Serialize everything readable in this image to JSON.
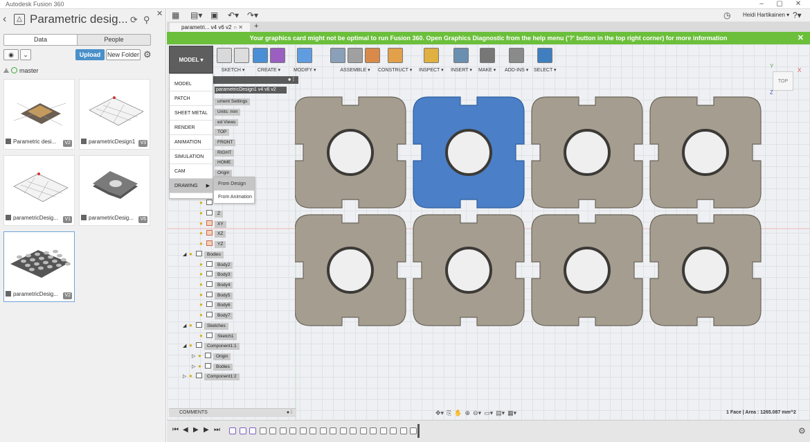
{
  "window": {
    "title": "Autodesk Fusion 360",
    "min": "–",
    "max": "▢",
    "close": "✕"
  },
  "data_panel": {
    "project_title": "Parametric desig...",
    "tabs": [
      {
        "label": "Data",
        "active": true
      },
      {
        "label": "People",
        "active": false
      }
    ],
    "upload_label": "Upload",
    "new_folder_label": "New Folder",
    "branch": "master",
    "thumbnails": [
      {
        "name": "Parametric desi...",
        "version": "V2",
        "kind": "tile",
        "selected": false
      },
      {
        "name": "parametricDesign1",
        "version": "V3",
        "kind": "assembly",
        "selected": false
      },
      {
        "name": "parametricDesig...",
        "version": "V1",
        "kind": "assembly",
        "selected": false
      },
      {
        "name": "parametricDesig...",
        "version": "V6",
        "kind": "cross",
        "selected": false
      },
      {
        "name": "parametricDesig...",
        "version": "V2",
        "kind": "grid",
        "selected": true
      }
    ]
  },
  "app": {
    "user_name": "Heidi Hartikainen ▾",
    "doc_tab": "parametri... v4 v6 v2",
    "warning": "Your graphics card might not be optimal to run Fusion 360. Open Graphics Diagnostic from the help menu ('?' button in the top right corner) for more information",
    "workspace_button": "MODEL ▾",
    "ribbon_groups": [
      {
        "label": "SKETCH ▾",
        "colors": [
          "#d9d9d9",
          "#dddddd"
        ]
      },
      {
        "label": "CREATE ▾",
        "colors": [
          "#4a8fd6",
          "#9a5fc0"
        ]
      },
      {
        "label": "MODIFY ▾",
        "colors": [
          "#5f9de0"
        ]
      },
      {
        "label": "ASSEMBLE ▾",
        "colors": [
          "#8aa0b8",
          "#a0a0a0",
          "#d98a4a"
        ]
      },
      {
        "label": "CONSTRUCT ▾",
        "colors": [
          "#e2a04a"
        ]
      },
      {
        "label": "INSPECT ▾",
        "colors": [
          "#e0b040"
        ]
      },
      {
        "label": "INSERT ▾",
        "colors": [
          "#6a8fb0"
        ]
      },
      {
        "label": "MAKE ▾",
        "colors": [
          "#777777"
        ]
      },
      {
        "label": "ADD-INS ▾",
        "colors": [
          "#8a8a8a"
        ]
      },
      {
        "label": "SELECT ▾",
        "colors": [
          "#3f7fbf"
        ]
      }
    ],
    "workspaces": [
      {
        "label": "MODEL"
      },
      {
        "label": "PATCH"
      },
      {
        "label": "SHEET METAL"
      },
      {
        "label": "RENDER"
      },
      {
        "label": "ANIMATION"
      },
      {
        "label": "SIMULATION"
      },
      {
        "label": "CAM"
      },
      {
        "label": "DRAWING",
        "highlighted": true
      }
    ],
    "drawing_submenu": [
      "From Design",
      "From Animation"
    ],
    "browser_title": "parametricDesign1 v4 v6 v2",
    "browser_nodes": [
      {
        "label": "ument Settings"
      },
      {
        "label": "Units: mm"
      },
      {
        "label": "ed Views"
      },
      {
        "label": "TOP"
      },
      {
        "label": "FRONT"
      },
      {
        "label": "RIGHT"
      },
      {
        "label": "HOME"
      },
      {
        "label": "Origin"
      },
      {
        "label": "Z"
      },
      {
        "label": "XY"
      },
      {
        "label": "XZ"
      },
      {
        "label": "YZ"
      },
      {
        "label": "Bodies"
      },
      {
        "label": "Body2"
      },
      {
        "label": "Body3"
      },
      {
        "label": "Body4"
      },
      {
        "label": "Body5"
      },
      {
        "label": "Body6"
      },
      {
        "label": "Body7"
      },
      {
        "label": "Sketches"
      },
      {
        "label": "Sketch1"
      },
      {
        "label": "Component1:1"
      },
      {
        "label": "Origin"
      },
      {
        "label": "Bodies"
      },
      {
        "label": "Component1:2"
      }
    ],
    "viewcube_label": "TOP",
    "axis_x": "X",
    "axis_y": "Y",
    "axis_z": "Z",
    "comments_label": "COMMENTS",
    "status": "1 Face | Area : 1265.087 mm^2",
    "part_color": "#a59d8f",
    "part_selected_color": "#4b7fc7"
  }
}
